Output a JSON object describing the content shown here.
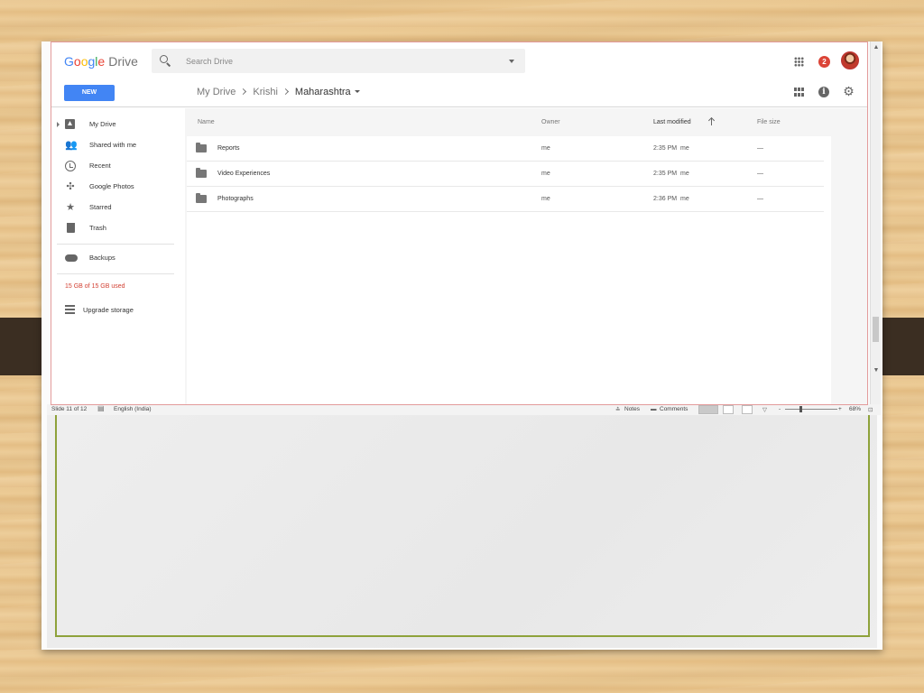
{
  "drive": {
    "logo_letters": [
      "G",
      "o",
      "o",
      "g",
      "l",
      "e"
    ],
    "logo_product": "Drive",
    "search_placeholder": "Search Drive",
    "notification_count": "2",
    "new_button": "NEW",
    "breadcrumb": [
      "My Drive",
      "Krishi",
      "Maharashtra"
    ],
    "icons": {
      "search": "search-icon",
      "apps": "apps-grid-icon",
      "grid_view": "grid-view-icon",
      "info": "info-icon",
      "settings": "gear-icon",
      "sort": "arrow-up-icon",
      "folder": "folder-icon"
    },
    "sidebar": {
      "items": [
        {
          "label": "My Drive",
          "icon": "drive-icon"
        },
        {
          "label": "Shared with me",
          "icon": "people-icon"
        },
        {
          "label": "Recent",
          "icon": "clock-icon"
        },
        {
          "label": "Google Photos",
          "icon": "pinwheel-icon"
        },
        {
          "label": "Starred",
          "icon": "star-icon"
        },
        {
          "label": "Trash",
          "icon": "trash-icon"
        }
      ],
      "backups": {
        "label": "Backups",
        "icon": "cloud-icon"
      },
      "quota": "15 GB of 15 GB used",
      "upgrade": {
        "label": "Upgrade storage",
        "icon": "storage-icon"
      }
    },
    "columns": {
      "name": "Name",
      "owner": "Owner",
      "modified": "Last modified",
      "size": "File size"
    },
    "files": [
      {
        "name": "Reports",
        "owner": "me",
        "modified": "2:35 PM",
        "modified_by": "me",
        "size": "—"
      },
      {
        "name": "Video Experiences",
        "owner": "me",
        "modified": "2:35 PM",
        "modified_by": "me",
        "size": "—"
      },
      {
        "name": "Photographs",
        "owner": "me",
        "modified": "2:36 PM",
        "modified_by": "me",
        "size": "—"
      }
    ],
    "colors": {
      "new_button": "#4285f4",
      "notification": "#db4437",
      "quota_text": "#d23f31"
    }
  },
  "powerpoint": {
    "slide_info": "Slide 11 of 12",
    "language": "English (India)",
    "notes": "Notes",
    "comments": "Comments",
    "zoom_out": "-",
    "zoom_in": "+",
    "zoom": "68%",
    "border_color": "#8ea23b"
  }
}
